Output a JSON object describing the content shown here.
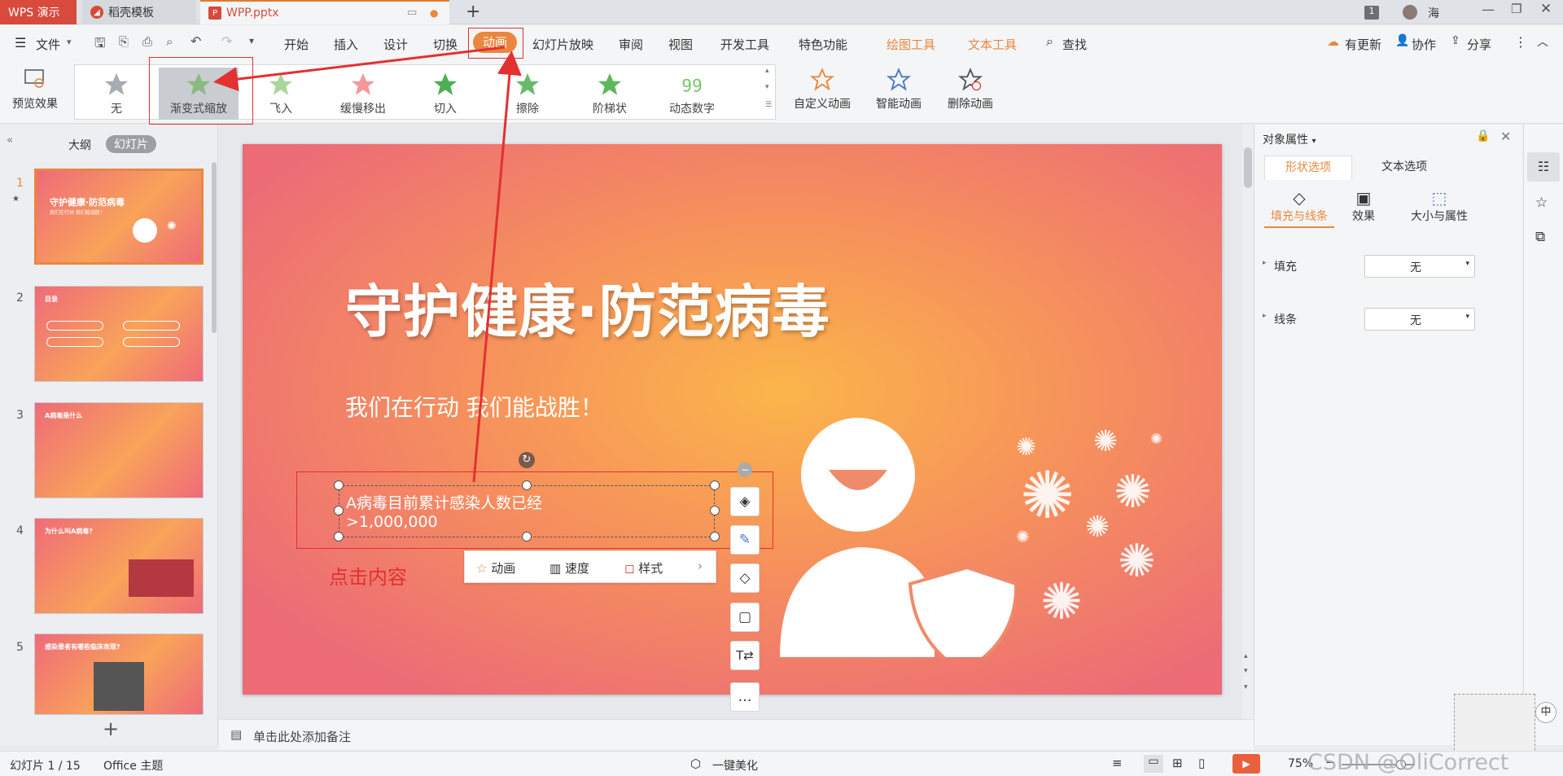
{
  "titlebar": {
    "tabs": [
      {
        "label": "WPS 演示"
      },
      {
        "label": "稻壳模板"
      },
      {
        "label": "WPP.pptx"
      }
    ],
    "new_tab": "+",
    "badge": "1",
    "user": "海"
  },
  "menubar": {
    "file": "文件",
    "items": [
      "开始",
      "插入",
      "设计",
      "切换",
      "动画",
      "幻灯片放映",
      "审阅",
      "视图",
      "开发工具",
      "特色功能"
    ],
    "tool_tabs": [
      "绘图工具",
      "文本工具"
    ],
    "search": "查找",
    "right": [
      "有更新",
      "协作",
      "分享"
    ]
  },
  "ribbon": {
    "preview": "预览效果",
    "animations": [
      "无",
      "渐变式缩放",
      "飞入",
      "缓慢移出",
      "切入",
      "擦除",
      "阶梯状",
      "动态数字"
    ],
    "actions": [
      "自定义动画",
      "智能动画",
      "删除动画"
    ]
  },
  "leftpanel": {
    "tabs": [
      "大纲",
      "幻灯片"
    ],
    "slides": [
      {
        "num": "1",
        "title": "守护健康·防范病毒",
        "sub": "我们在行动 我们能战胜！"
      },
      {
        "num": "2",
        "title": "目录"
      },
      {
        "num": "3",
        "title": "A病毒是什么"
      },
      {
        "num": "4",
        "title": "为什么叫A病毒?"
      },
      {
        "num": "5",
        "title": "感染患者有哪些临床表现?"
      }
    ],
    "add": "+"
  },
  "slide": {
    "title": "守护健康·防范病毒",
    "subtitle": "我们在行动 我们能战胜！",
    "textbox_line1": "A病毒目前累计感染人数已经",
    "textbox_line2": ">1,000,000",
    "annotation": "点击内容"
  },
  "quickbar": {
    "items": [
      "动画",
      "速度",
      "样式"
    ]
  },
  "notes": "单击此处添加备注",
  "rightpanel": {
    "title": "对象属性",
    "tabs": [
      "形状选项",
      "文本选项"
    ],
    "subtabs": [
      "填充与线条",
      "效果",
      "大小与属性"
    ],
    "rows": [
      {
        "label": "填充",
        "value": "无"
      },
      {
        "label": "线条",
        "value": "无"
      }
    ]
  },
  "statusbar": {
    "slide_info": "幻灯片 1 / 15",
    "theme": "Office 主题",
    "beautify": "一键美化",
    "zoom": "75%",
    "watermark": "CSDN @OliCorrect",
    "ime": "中"
  },
  "colors": {
    "accent": "#d84a3c",
    "orange": "#e9873f",
    "annotation_red": "#e33030"
  }
}
